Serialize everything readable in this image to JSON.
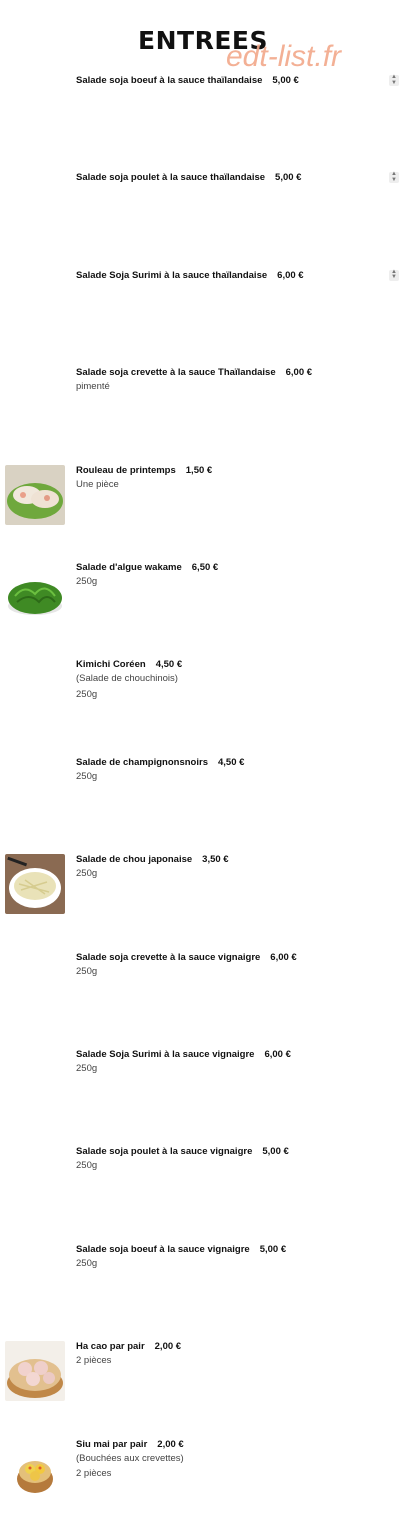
{
  "header": {
    "title": "ENTREES",
    "watermark": "edt-list.fr"
  },
  "items": [
    {
      "name": "Salade soja boeuf à la sauce thaïlandaise",
      "price": "5,00 €",
      "sub": [],
      "image": null,
      "stepper": true
    },
    {
      "name": "Salade soja poulet à la sauce thaïlandaise",
      "price": "5,00 €",
      "sub": [],
      "image": null,
      "stepper": true
    },
    {
      "name": "Salade Soja Surimi à la sauce thaïlandaise",
      "price": "6,00 €",
      "sub": [],
      "image": null,
      "stepper": true
    },
    {
      "name": "Salade soja crevette à la sauce Thaïlandaise",
      "price": "6,00 €",
      "sub": [
        "pimenté"
      ],
      "image": null,
      "stepper": false
    },
    {
      "name": "Rouleau de printemps",
      "price": "1,50 €",
      "sub": [
        "Une pièce"
      ],
      "image": "spring-rolls",
      "stepper": false
    },
    {
      "name": "Salade d'algue wakame",
      "price": "6,50 €",
      "sub": [
        "250g"
      ],
      "image": "wakame",
      "stepper": false
    },
    {
      "name": "Kimichi Coréen",
      "price": "4,50 €",
      "sub": [
        "(Salade de chouchinois)",
        "250g"
      ],
      "image": null,
      "stepper": false
    },
    {
      "name": "Salade de champignonsnoirs",
      "price": "4,50 €",
      "sub": [
        "250g"
      ],
      "image": null,
      "stepper": false
    },
    {
      "name": "Salade de chou japonaise",
      "price": "3,50 €",
      "sub": [
        "250g"
      ],
      "image": "cabbage",
      "stepper": false
    },
    {
      "name": "Salade soja crevette à la sauce vignaigre",
      "price": "6,00 €",
      "sub": [
        "250g"
      ],
      "image": null,
      "stepper": false
    },
    {
      "name": "Salade Soja Surimi à la sauce vignaigre",
      "price": "6,00 €",
      "sub": [
        "250g"
      ],
      "image": null,
      "stepper": false
    },
    {
      "name": "Salade soja poulet à la sauce vignaigre",
      "price": "5,00 €",
      "sub": [
        "250g"
      ],
      "image": null,
      "stepper": false
    },
    {
      "name": "Salade soja boeuf à la sauce vignaigre",
      "price": "5,00 €",
      "sub": [
        "250g"
      ],
      "image": null,
      "stepper": false
    },
    {
      "name": "Ha cao par pair",
      "price": "2,00 €",
      "sub": [
        "2 pièces"
      ],
      "image": "ha-cao",
      "stepper": false
    },
    {
      "name": "Siu mai par pair",
      "price": "2,00 €",
      "sub": [
        "(Bouchées aux crevettes)",
        "2 pièces"
      ],
      "image": "siu-mai",
      "stepper": false
    }
  ]
}
